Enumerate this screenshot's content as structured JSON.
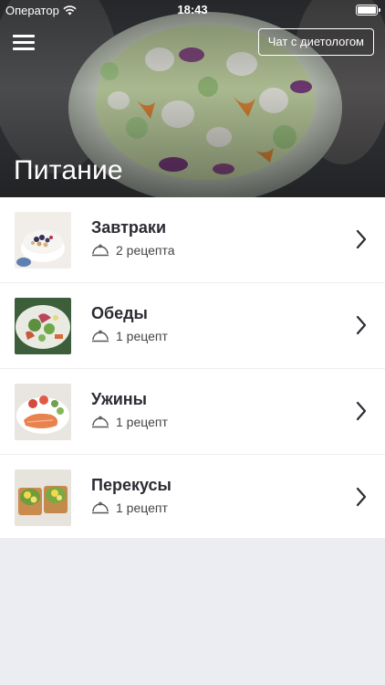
{
  "status_bar": {
    "carrier": "Оператор",
    "time": "18:43"
  },
  "header": {
    "chat_button_label": "Чат с диетологом",
    "title": "Питание"
  },
  "categories": [
    {
      "title": "Завтраки",
      "recipes": "2 рецепта"
    },
    {
      "title": "Обеды",
      "recipes": "1 рецепт"
    },
    {
      "title": "Ужины",
      "recipes": "1 рецепт"
    },
    {
      "title": "Перекусы",
      "recipes": "1 рецепт"
    }
  ]
}
